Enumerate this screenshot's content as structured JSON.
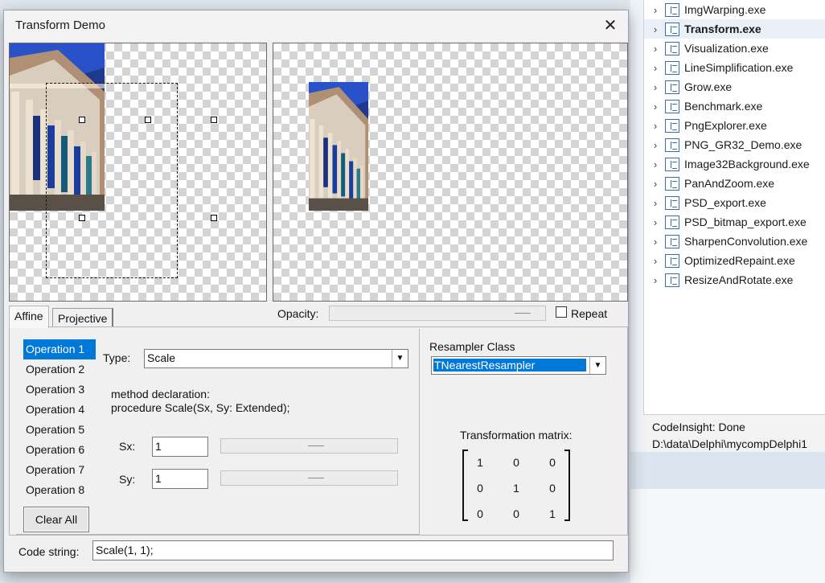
{
  "ide": {
    "files": [
      {
        "name": "ImgWarping.exe",
        "selected": false
      },
      {
        "name": "Transform.exe",
        "selected": true
      },
      {
        "name": "Visualization.exe",
        "selected": false
      },
      {
        "name": "LineSimplification.exe",
        "selected": false
      },
      {
        "name": "Grow.exe",
        "selected": false
      },
      {
        "name": "Benchmark.exe",
        "selected": false
      },
      {
        "name": "PngExplorer.exe",
        "selected": false
      },
      {
        "name": "PNG_GR32_Demo.exe",
        "selected": false
      },
      {
        "name": "Image32Background.exe",
        "selected": false
      },
      {
        "name": "PanAndZoom.exe",
        "selected": false
      },
      {
        "name": "PSD_export.exe",
        "selected": false
      },
      {
        "name": "PSD_bitmap_export.exe",
        "selected": false
      },
      {
        "name": "SharpenConvolution.exe",
        "selected": false
      },
      {
        "name": "OptimizedRepaint.exe",
        "selected": false
      },
      {
        "name": "ResizeAndRotate.exe",
        "selected": false
      }
    ],
    "status_line1": "CodeInsight: Done",
    "status_line2": "D:\\data\\Delphi\\mycompDelphi1"
  },
  "dialog": {
    "title": "Transform Demo",
    "close_glyph": "✕",
    "opacity_label": "Opacity:",
    "repeat_label": "Repeat",
    "repeat_checked": false,
    "tabs": [
      {
        "label": "Affine",
        "active": true
      },
      {
        "label": "Projective",
        "active": false
      }
    ],
    "operations": [
      "Operation 1",
      "Operation 2",
      "Operation 3",
      "Operation 4",
      "Operation 5",
      "Operation 6",
      "Operation 7",
      "Operation 8"
    ],
    "selected_operation_index": 0,
    "clear_all_label": "Clear All",
    "type_label": "Type:",
    "type_value": "Scale",
    "method_caption": "method declaration:",
    "method_signature": "procedure Scale(Sx, Sy: Extended);",
    "sx_label": "Sx:",
    "sx_value": "1",
    "sy_label": "Sy:",
    "sy_value": "1",
    "resampler_label": "Resampler Class",
    "resampler_value": "TNearestResampler",
    "matrix_label": "Transformation matrix:",
    "matrix": [
      [
        "1",
        "0",
        "0"
      ],
      [
        "0",
        "1",
        "0"
      ],
      [
        "0",
        "0",
        "1"
      ]
    ],
    "code_label": "Code string:",
    "code_value": "Scale(1, 1);"
  },
  "colors": {
    "selection": "#0078d7",
    "checker_dark": "#d4d4d4",
    "dialog_bg": "#f0f0f0"
  }
}
